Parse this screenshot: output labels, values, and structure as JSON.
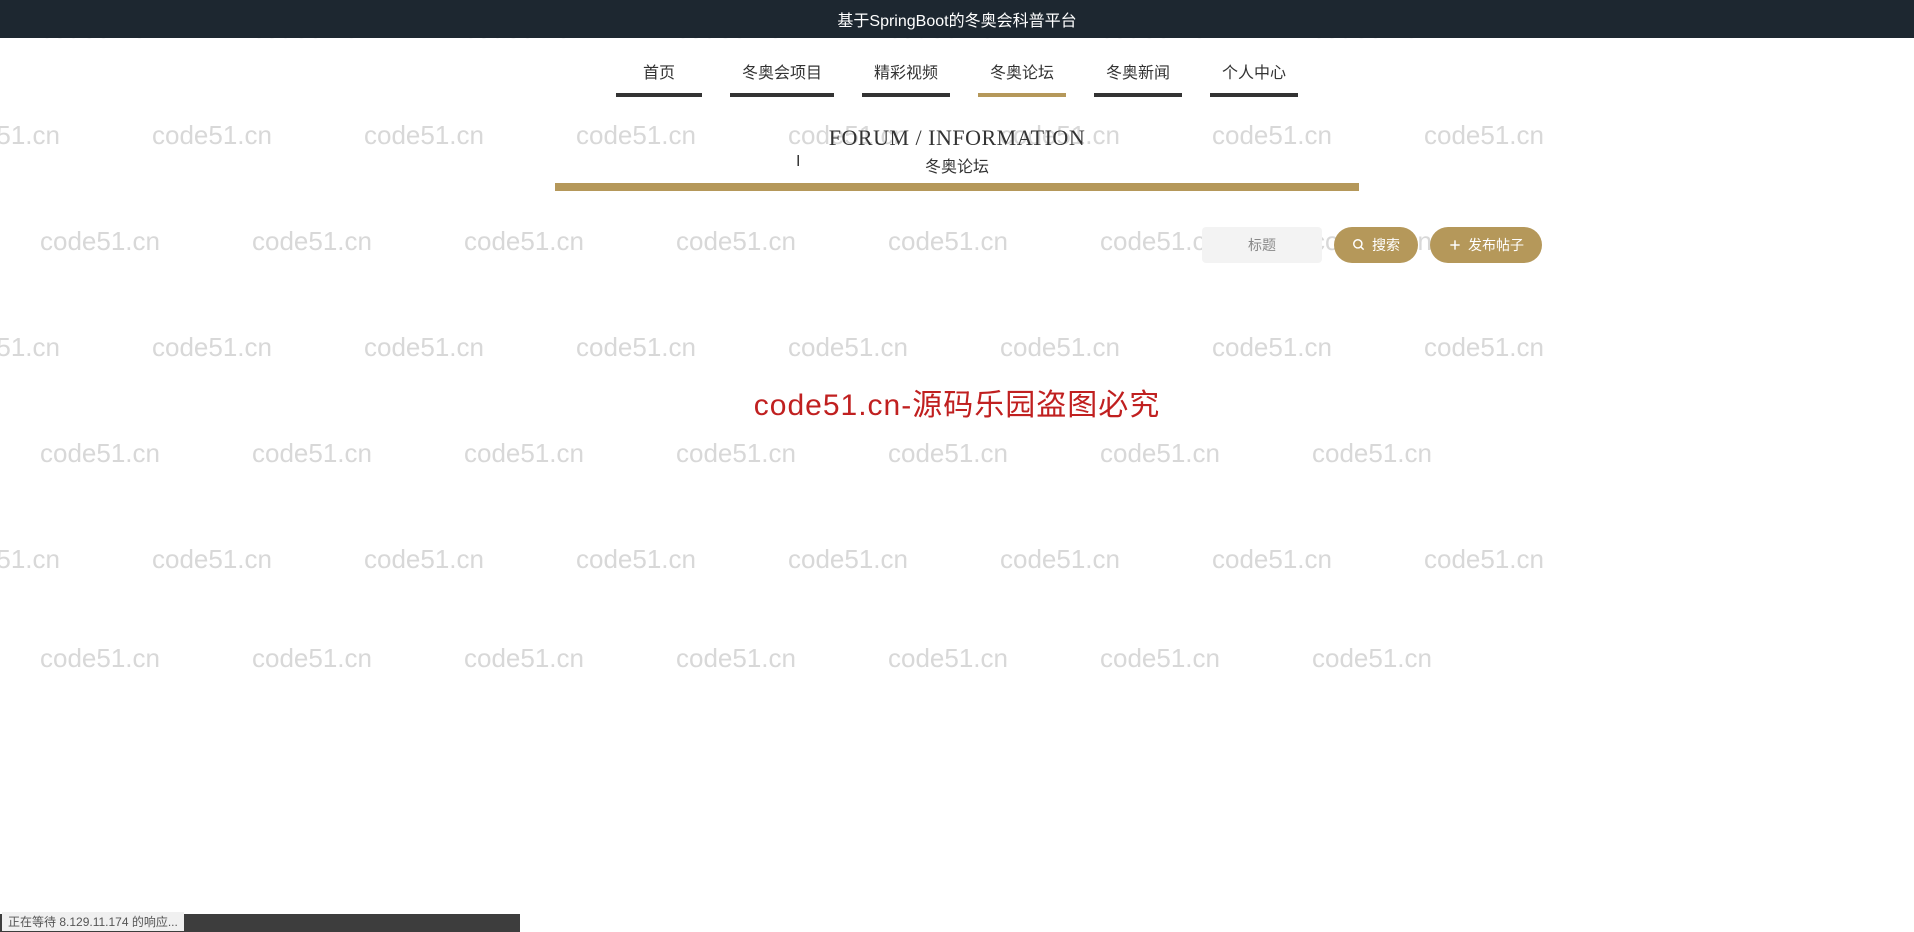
{
  "header": {
    "title": "基于SpringBoot的冬奥会科普平台"
  },
  "nav": {
    "items": [
      {
        "label": "首页"
      },
      {
        "label": "冬奥会项目"
      },
      {
        "label": "精彩视频"
      },
      {
        "label": "冬奥论坛"
      },
      {
        "label": "冬奥新闻"
      },
      {
        "label": "个人中心"
      }
    ],
    "active_index": 3
  },
  "section": {
    "title_en": "FORUM / INFORMATION",
    "title_cn": "冬奥论坛"
  },
  "toolbar": {
    "search_placeholder": "标题",
    "search_button": "搜索",
    "post_button": "发布帖子"
  },
  "watermark": {
    "text": "code51.cn",
    "center_notice": "code51.cn-源码乐园盗图必究"
  },
  "statusbar": {
    "text": "正在等待 8.129.11.174 的响应..."
  }
}
